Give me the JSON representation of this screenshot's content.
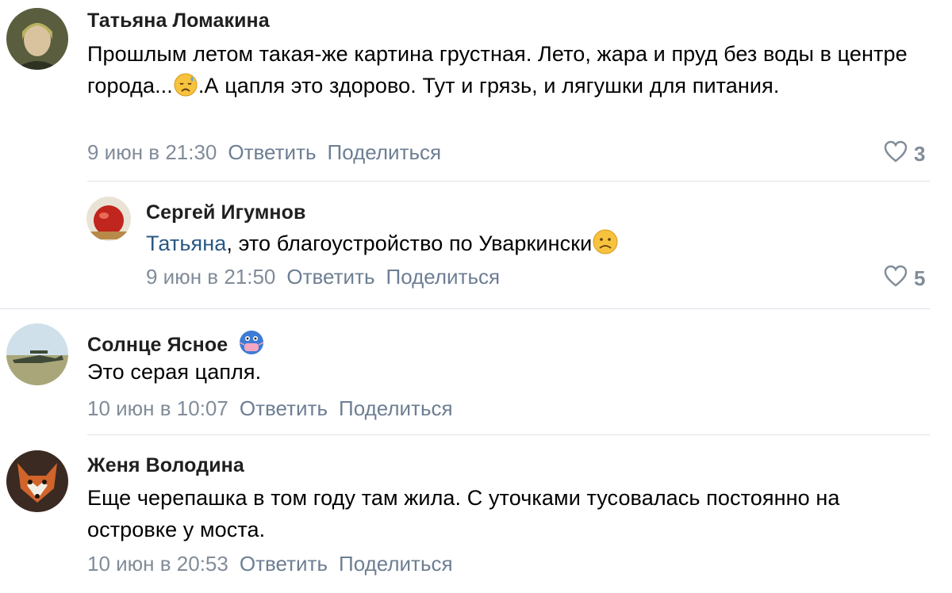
{
  "comments": [
    {
      "author": "Татьяна Ломакина",
      "text_part1": "Прошлым летом такая-же картина грустная. Лето, жара и пруд без воды в центре города...",
      "text_part2": ".А цапля это здорово. Тут и грязь, и лягушки для питания.",
      "emoji_icon": "sad-sweat-emoji",
      "date": "9 июн в 21:30",
      "reply_label": "Ответить",
      "share_label": "Поделиться",
      "likes": "3"
    },
    {
      "author": "Сергей Игумнов",
      "mention": "Татьяна",
      "text": ", это благоустройство по Уваркински",
      "emoji_icon": "frowning-face-emoji",
      "date": "9 июн в 21:50",
      "reply_label": "Ответить",
      "share_label": "Поделиться",
      "likes": "5"
    },
    {
      "author": "Солнце Ясное",
      "badge_icon": "medical-mask-emoji",
      "text": "Это серая цапля.",
      "date": "10 июн в 10:07",
      "reply_label": "Ответить",
      "share_label": "Поделиться"
    },
    {
      "author": "Женя Володина",
      "text": "Еще черепашка в том году там жила. С уточками тусовалась постоянно на островке у моста.",
      "date": "10 июн в 20:53",
      "reply_label": "Ответить",
      "share_label": "Поделиться"
    }
  ],
  "icons": {
    "like": "heart-outline-icon"
  },
  "colors": {
    "link": "#2a5885",
    "meta": "#818c99",
    "action": "#6d7e93",
    "divider": "#dce1e6"
  }
}
